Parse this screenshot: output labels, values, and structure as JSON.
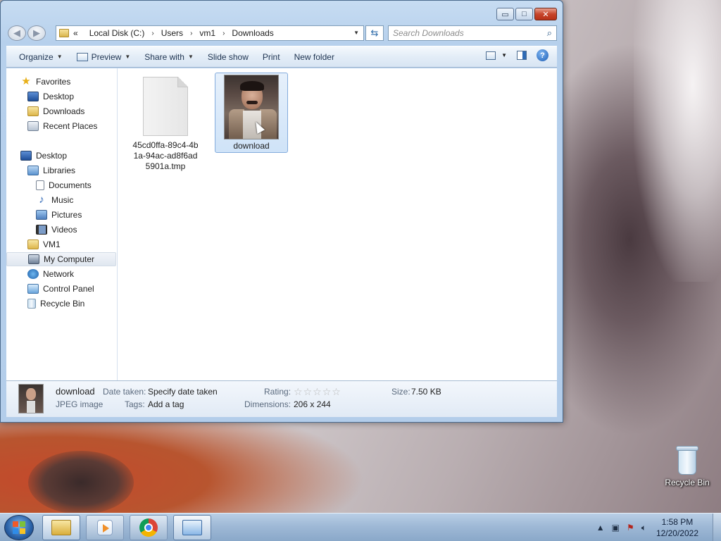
{
  "window": {
    "caption_buttons": {
      "minimize": "▭",
      "maximize": "□",
      "close": "✕"
    },
    "address": {
      "overflow": "«",
      "crumbs": [
        "Local Disk (C:)",
        "Users",
        "vm1",
        "Downloads"
      ]
    },
    "search_placeholder": "Search Downloads",
    "toolbar": {
      "organize": "Organize",
      "preview": "Preview",
      "share_with": "Share with",
      "slide_show": "Slide show",
      "print": "Print",
      "new_folder": "New folder",
      "help": "?"
    },
    "nav": {
      "favorites": "Favorites",
      "fav_desktop": "Desktop",
      "fav_downloads": "Downloads",
      "fav_recent": "Recent Places",
      "desktop": "Desktop",
      "libraries": "Libraries",
      "documents": "Documents",
      "music": "Music",
      "pictures": "Pictures",
      "videos": "Videos",
      "vm1": "VM1",
      "my_computer": "My Computer",
      "network": "Network",
      "control_panel": "Control Panel",
      "recycle_bin": "Recycle Bin"
    },
    "files": [
      {
        "name": "45cd0ffa-89c4-4b1a-94ac-ad8f6ad5901a.tmp",
        "type": "tmp"
      },
      {
        "name": "download",
        "type": "jpeg",
        "selected": true
      }
    ],
    "details": {
      "name": "download",
      "type": "JPEG image",
      "date_taken_label": "Date taken:",
      "date_taken_value": "Specify date taken",
      "tags_label": "Tags:",
      "tags_value": "Add a tag",
      "rating_label": "Rating:",
      "rating_value": 0,
      "rating_max": 5,
      "dimensions_label": "Dimensions:",
      "dimensions_value": "206 x 244",
      "size_label": "Size:",
      "size_value": "7.50 KB"
    }
  },
  "desktop": {
    "icons": [
      {
        "label": "Recycle Bin",
        "icon": "recycle-bin-icon"
      }
    ]
  },
  "taskbar": {
    "buttons": [
      "windows-explorer",
      "windows-media-player",
      "google-chrome",
      "remote-desktop"
    ],
    "clock_time": "1:58 PM",
    "clock_date": "12/20/2022"
  },
  "colors": {
    "selection": "#cfe3f8",
    "close_button": "#c7452b",
    "taskbar": "#9fb9d6"
  }
}
